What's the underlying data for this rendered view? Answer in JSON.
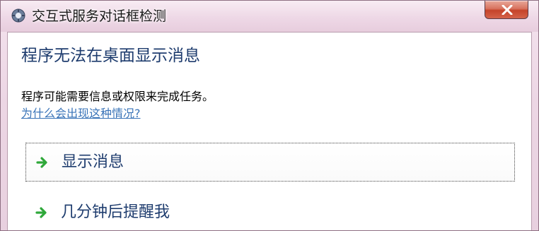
{
  "window": {
    "title": "交互式服务对话框检测"
  },
  "dialog": {
    "headline": "程序无法在桌面显示消息",
    "body": "程序可能需要信息或权限来完成任务。",
    "help_link": "为什么会出现这种情况?"
  },
  "options": [
    {
      "label": "显示消息",
      "icon": "green-arrow-icon"
    },
    {
      "label": "几分钟后提醒我",
      "icon": "green-arrow-icon"
    }
  ],
  "colors": {
    "headline": "#1e3c6e",
    "link": "#3a74b8",
    "arrow": "#2fa83a",
    "close_button": "#c5432a"
  }
}
